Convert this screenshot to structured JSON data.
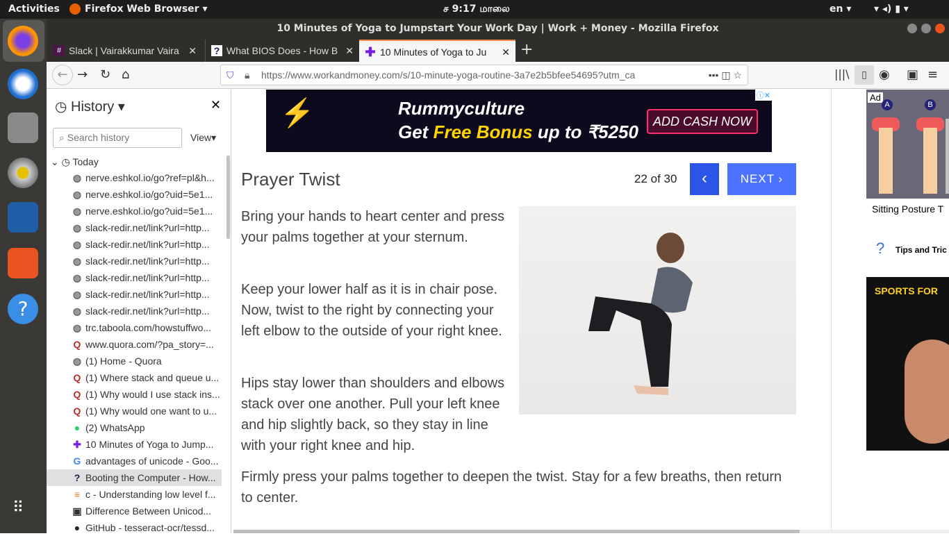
{
  "system": {
    "activities": "Activities",
    "app_menu": "Firefox Web Browser ▾",
    "clock": "ச  9:17 மாலை",
    "lang": "en ▾"
  },
  "window": {
    "title": "10 Minutes of Yoga to Jumpstart Your Work Day | Work + Money - Mozilla Firefox"
  },
  "tabs": [
    {
      "label": "Slack | Vairakkumar Vaira",
      "icon": "#"
    },
    {
      "label": "What BIOS Does - How B",
      "icon": "?"
    },
    {
      "label": "10 Minutes of Yoga to Ju",
      "icon": "✚"
    }
  ],
  "nav": {
    "url": "https://www.workandmoney.com/s/10-minute-yoga-routine-3a7e2b5bfee54695?utm_ca",
    "url_domain": "workandmoney.com"
  },
  "sidebar": {
    "title": "History",
    "search_placeholder": "Search history",
    "view": "View",
    "group": "Today",
    "items": [
      {
        "label": "nerve.eshkol.io/go?ref=pl&h...",
        "icon": "globe"
      },
      {
        "label": "nerve.eshkol.io/go?uid=5e1...",
        "icon": "globe"
      },
      {
        "label": "nerve.eshkol.io/go?uid=5e1...",
        "icon": "globe"
      },
      {
        "label": "slack-redir.net/link?url=http...",
        "icon": "globe"
      },
      {
        "label": "slack-redir.net/link?url=http...",
        "icon": "globe"
      },
      {
        "label": "slack-redir.net/link?url=http...",
        "icon": "globe"
      },
      {
        "label": "slack-redir.net/link?url=http...",
        "icon": "globe"
      },
      {
        "label": "slack-redir.net/link?url=http...",
        "icon": "globe"
      },
      {
        "label": "slack-redir.net/link?url=http...",
        "icon": "globe"
      },
      {
        "label": "trc.taboola.com/howstuffwo...",
        "icon": "globe"
      },
      {
        "label": "www.quora.com/?pa_story=...",
        "icon": "quora"
      },
      {
        "label": "(1) Home - Quora",
        "icon": "globe"
      },
      {
        "label": "(1) Where stack and queue u...",
        "icon": "quora"
      },
      {
        "label": "(1) Why would I use stack ins...",
        "icon": "quora"
      },
      {
        "label": "(1) Why would one want to u...",
        "icon": "quora"
      },
      {
        "label": "(2) WhatsApp",
        "icon": "whatsapp"
      },
      {
        "label": "10 Minutes of Yoga to Jump...",
        "icon": "plus"
      },
      {
        "label": "advantages of unicode - Goo...",
        "icon": "google"
      },
      {
        "label": "Booting the Computer - How...",
        "icon": "hsw"
      },
      {
        "label": "c - Understanding low level f...",
        "icon": "stackoverflow"
      },
      {
        "label": "Difference Between Unicod...",
        "icon": "db"
      },
      {
        "label": "GitHub - tesseract-ocr/tessd...",
        "icon": "github"
      }
    ]
  },
  "ad": {
    "brand": "Rummyculture",
    "line_pre": "Get ",
    "line_hl": "Free Bonus",
    "line_post": " up to ₹5250",
    "cta": "ADD CASH NOW"
  },
  "article": {
    "title": "Prayer Twist",
    "counter": "22 of 30",
    "prev": "‹",
    "next": "NEXT ›",
    "paragraphs": [
      "Bring your hands to heart center and press your palms together at your sternum.",
      "Keep your lower half as it is in chair pose. Now,  twist to the right by connecting your left elbow to the outside of your right knee.",
      "Hips stay lower than shoulders and elbows stack over one another. Pull your left knee and hip slightly back, so they stay in line with your right knee and hip.",
      "Firmly press your palms together to deepen the twist. Stay for a few breaths, then return to center."
    ]
  },
  "right_ads": {
    "ad_badge": "Ad",
    "label_a": "A",
    "label_b": "B",
    "caption": "Sitting Posture T",
    "tips": "Tips and Tric",
    "sports": "SPORTS FOR"
  }
}
